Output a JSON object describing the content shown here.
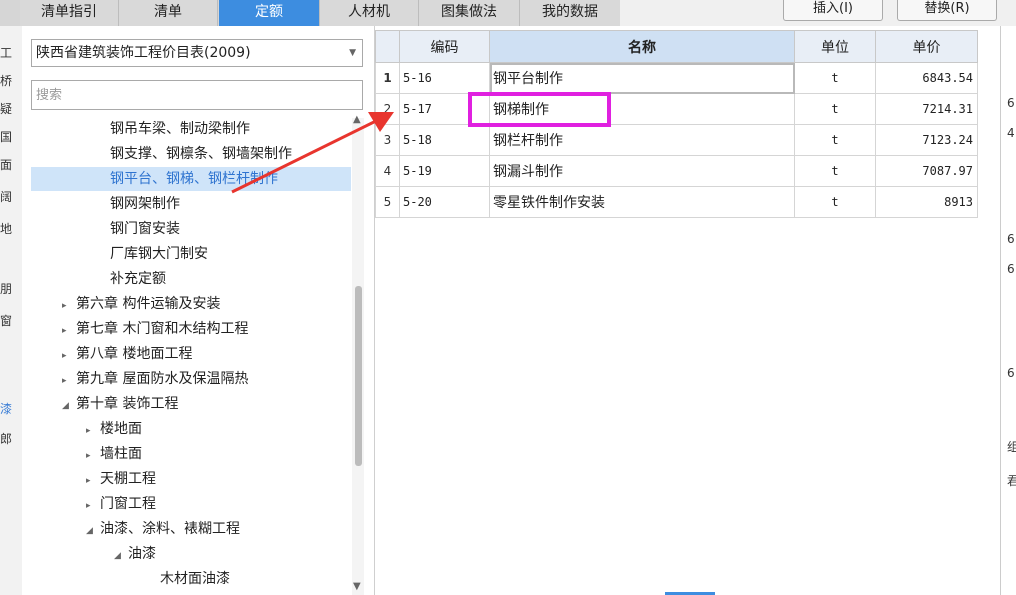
{
  "tabs": [
    {
      "label": "清单指引",
      "active": false
    },
    {
      "label": "清单",
      "active": false
    },
    {
      "label": "定额",
      "active": true
    },
    {
      "label": "人材机",
      "active": false
    },
    {
      "label": "图集做法",
      "active": false
    },
    {
      "label": "我的数据",
      "active": false
    }
  ],
  "buttons": {
    "insert": "插入(I)",
    "replace": "替换(R)"
  },
  "left_strip": [
    "工",
    "桥",
    "疑",
    "国",
    "面",
    "阔",
    "地",
    "朋",
    "窗",
    "漆",
    "郎"
  ],
  "quota_select": {
    "value": "陕西省建筑装饰工程价目表(2009)"
  },
  "search": {
    "placeholder": "搜索"
  },
  "tree": [
    {
      "label": "钢吊车梁、制动梁制作",
      "arrow": ""
    },
    {
      "label": "钢支撑、钢檩条、钢墙架制作",
      "arrow": ""
    },
    {
      "label": "钢平台、钢梯、钢栏杆制作",
      "arrow": "",
      "selected": true
    },
    {
      "label": "钢网架制作",
      "arrow": ""
    },
    {
      "label": "钢门窗安装",
      "arrow": ""
    },
    {
      "label": "厂库钢大门制安",
      "arrow": ""
    },
    {
      "label": "补充定额",
      "arrow": ""
    },
    {
      "label": "第六章 构件运输及安装",
      "arrow": "▸"
    },
    {
      "label": "第七章 木门窗和木结构工程",
      "arrow": "▸"
    },
    {
      "label": "第八章 楼地面工程",
      "arrow": "▸"
    },
    {
      "label": "第九章 屋面防水及保温隔热",
      "arrow": "▸"
    },
    {
      "label": "第十章 装饰工程",
      "arrow": "◢"
    },
    {
      "label": "楼地面",
      "arrow": "▸"
    },
    {
      "label": "墙柱面",
      "arrow": "▸"
    },
    {
      "label": "天棚工程",
      "arrow": "▸"
    },
    {
      "label": "门窗工程",
      "arrow": "▸"
    },
    {
      "label": "油漆、涂料、裱糊工程",
      "arrow": "◢"
    },
    {
      "label": "油漆",
      "arrow": "◢"
    },
    {
      "label": "木材面油漆",
      "arrow": ""
    }
  ],
  "grid": {
    "headers": {
      "code": "编码",
      "name": "名称",
      "unit": "单位",
      "price": "单价"
    },
    "rows": [
      {
        "idx": "1",
        "code": "5-16",
        "name": "钢平台制作",
        "unit": "t",
        "price": "6843.54"
      },
      {
        "idx": "2",
        "code": "5-17",
        "name": "钢梯制作",
        "unit": "t",
        "price": "7214.31"
      },
      {
        "idx": "3",
        "code": "5-18",
        "name": "钢栏杆制作",
        "unit": "t",
        "price": "7123.24"
      },
      {
        "idx": "4",
        "code": "5-19",
        "name": "钢漏斗制作",
        "unit": "t",
        "price": "7087.97"
      },
      {
        "idx": "5",
        "code": "5-20",
        "name": "零星铁件制作安装",
        "unit": "t",
        "price": "8913"
      }
    ]
  },
  "right_strip": [
    "6",
    "4",
    "6",
    "6",
    "6",
    "组",
    "君"
  ],
  "colors": {
    "accent": "#3d8de0",
    "highlight": "#e020e0",
    "arrow": "#e8352e"
  }
}
